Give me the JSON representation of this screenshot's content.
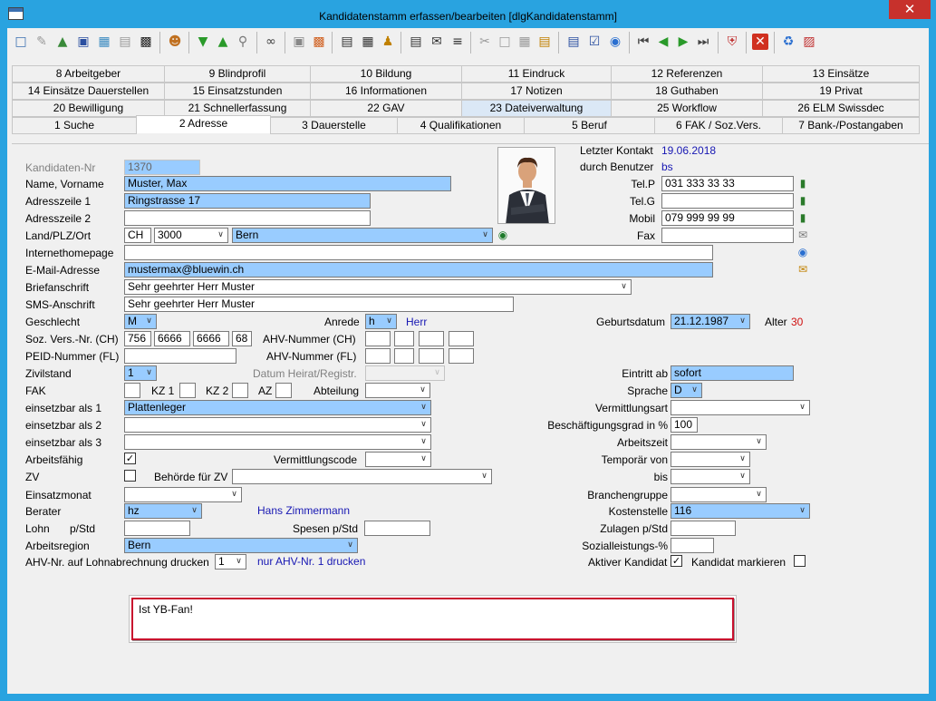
{
  "window": {
    "title": "Kandidatenstamm erfassen/bearbeiten [dlgKandidatenstamm]",
    "close": "✕"
  },
  "tabs": {
    "row1": [
      "8 Arbeitgeber",
      "9 Blindprofil",
      "10 Bildung",
      "11 Eindruck",
      "12 Referenzen",
      "13 Einsätze"
    ],
    "row2": [
      "14 Einsätze Dauerstellen",
      "15 Einsatzstunden",
      "16 Informationen",
      "17 Notizen",
      "18 Guthaben",
      "19 Privat"
    ],
    "row3": [
      "20 Bewilligung",
      "21 Schnellerfassung",
      "22 GAV",
      "23 Dateiverwaltung",
      "25 Workflow",
      "26 ELM Swissdec"
    ],
    "row4": [
      "1 Suche",
      "2 Adresse",
      "3 Dauerstelle",
      "4 Qualifikationen",
      "5 Beruf",
      "6 FAK / Soz.Vers.",
      "7 Bank-/Postangaben"
    ]
  },
  "labels": {
    "kandidaten_nr": "Kandidaten-Nr",
    "name": "Name, Vorname",
    "adr1": "Adresszeile 1",
    "adr2": "Adresszeile 2",
    "land": "Land/PLZ/Ort",
    "internet": "Internethomepage",
    "email": "E-Mail-Adresse",
    "briefanschrift": "Briefanschrift",
    "sms": "SMS-Anschrift",
    "geschlecht": "Geschlecht",
    "anrede": "Anrede",
    "sozvers": "Soz. Vers.-Nr. (CH)",
    "ahv_ch": "AHV-Nummer (CH)",
    "peid": "PEID-Nummer (FL)",
    "ahv_fl": "AHV-Nummer (FL)",
    "zivilstand": "Zivilstand",
    "datum_heirat": "Datum Heirat/Registr.",
    "fak": "FAK",
    "kz1": "KZ 1",
    "kz2": "KZ 2",
    "az": "AZ",
    "abteilung": "Abteilung",
    "einsetzbar1": "einsetzbar als 1",
    "einsetzbar2": "einsetzbar als 2",
    "einsetzbar3": "einsetzbar als 3",
    "arbeitsfaehig": "Arbeitsfähig",
    "vermittlungscode": "Vermittlungscode",
    "zv": "ZV",
    "behoerde": "Behörde für ZV",
    "einsatzmonat": "Einsatzmonat",
    "berater": "Berater",
    "lohn": "Lohn",
    "pstd": "p/Std",
    "spesen": "Spesen p/Std",
    "arbeitsregion": "Arbeitsregion",
    "ahv_lohn": "AHV-Nr. auf Lohnabrechnung drucken",
    "letzter_kontakt": "Letzter Kontakt",
    "durch_benutzer": "durch Benutzer",
    "telp": "Tel.P",
    "telg": "Tel.G",
    "mobil": "Mobil",
    "fax": "Fax",
    "geburtsdatum": "Geburtsdatum",
    "alter": "Alter",
    "eintritt": "Eintritt ab",
    "sprache": "Sprache",
    "vermittlungsart": "Vermittlungsart",
    "beschaeftigungsgrad": "Beschäftigungsgrad in %",
    "arbeitszeit": "Arbeitszeit",
    "temporaer": "Temporär von",
    "bis": "bis",
    "branchengruppe": "Branchengruppe",
    "kostenstelle": "Kostenstelle",
    "zulagen": "Zulagen p/Std",
    "sozialleistungen": "Sozialleistungs-%",
    "aktiver": "Aktiver Kandidat",
    "markieren": "Kandidat markieren"
  },
  "values": {
    "kandidaten_nr": "1370",
    "name": "Muster, Max",
    "adr1": "Ringstrasse 17",
    "adr2": "",
    "land": "CH",
    "plz": "3000",
    "ort": "Bern",
    "internet": "",
    "email": "mustermax@bluewin.ch",
    "briefanschrift": "Sehr geehrter Herr Muster",
    "sms": "Sehr geehrter Herr Muster",
    "geschlecht": "M",
    "anrede": "h",
    "anrede_text": "Herr",
    "soz1": "756",
    "soz2": "6666",
    "soz3": "6666",
    "soz4": "68",
    "zivilstand": "1",
    "einsetzbar1": "Plattenleger",
    "arbeitsfaehig_check": "✓",
    "zv_check": "",
    "berater": "hz",
    "berater_name": "Hans Zimmermann",
    "arbeitsregion": "Bern",
    "ahv_lohn": "1",
    "ahv_lohn_text": "nur AHV-Nr. 1 drucken",
    "letzter_kontakt": "19.06.2018",
    "durch_benutzer": "bs",
    "telp": "031 333 33 33",
    "telg": "",
    "mobil": "079 999 99 99",
    "fax": "",
    "geburtsdatum": "21.12.1987",
    "alter": "30",
    "eintritt": "sofort",
    "sprache": "D",
    "beschaeftigungsgrad": "100",
    "kostenstelle": "116",
    "aktiver_check": "✓",
    "markieren_check": "",
    "notes": "Ist YB-Fan!"
  },
  "colors": {
    "titlebar": "#29a3e0",
    "field_highlight": "#99ccff",
    "notes_border": "#c8102e",
    "link_text": "#1717b3"
  }
}
